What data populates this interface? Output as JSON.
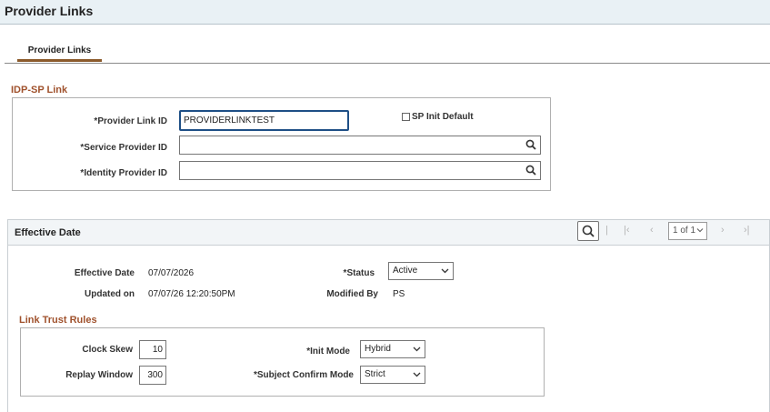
{
  "page": {
    "title": "Provider Links"
  },
  "tabs": [
    {
      "label": "Provider Links"
    }
  ],
  "idp_sp_link": {
    "section_title": "IDP-SP Link",
    "provider_link_id": {
      "label": "*Provider Link ID",
      "value": "PROVIDERLINKTEST"
    },
    "sp_init_default": {
      "label": "SP Init Default",
      "checked": false
    },
    "service_provider_id": {
      "label": "*Service Provider ID",
      "value": ""
    },
    "identity_provider_id": {
      "label": "*Identity Provider ID",
      "value": ""
    }
  },
  "effective_date_panel": {
    "title": "Effective Date",
    "toolbar": {
      "search_icon": "search-icon",
      "separator": "|",
      "first_glyph": "|‹",
      "prev_glyph": "‹",
      "page_indicator": "1 of 1",
      "next_glyph": "›",
      "last_glyph": "›|"
    },
    "effective_date": {
      "label": "Effective Date",
      "value": "07/07/2026"
    },
    "updated_on": {
      "label": "Updated on",
      "value": "07/07/26 12:20:50PM"
    },
    "status": {
      "label": "*Status",
      "value": "Active"
    },
    "modified_by": {
      "label": "Modified By",
      "value": "PS"
    }
  },
  "link_trust_rules": {
    "section_title": "Link Trust Rules",
    "clock_skew": {
      "label": "Clock Skew",
      "value": "10"
    },
    "replay_window": {
      "label": "Replay Window",
      "value": "300"
    },
    "init_mode": {
      "label": "*Init Mode",
      "value": "Hybrid"
    },
    "subject_confirm_mode": {
      "label": "*Subject Confirm Mode",
      "value": "Strict"
    }
  }
}
